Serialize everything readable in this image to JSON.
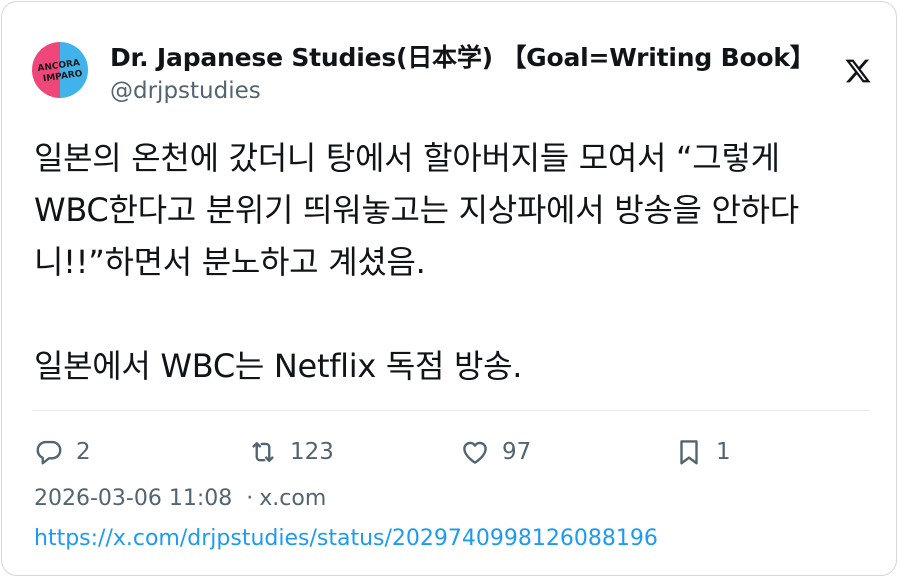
{
  "author": {
    "display_name": "Dr. Japanese Studies(日本学) 【Goal=Writing Book】",
    "handle": "@drjpstudies",
    "avatar_text": "ANCORA IMPARO"
  },
  "platform_icon": "x-logo-icon",
  "tweet": {
    "text": "일본의 온천에 갔더니 탕에서 할아버지들 모여서 “그렇게\nWBC한다고 분위기 띄워놓고는 지상파에서 방송을 안하다\n니!!”하면서 분노하고 계셨음.\n\n일본에서 WBC는 Netflix 독점 방송."
  },
  "actions": {
    "replies": "2",
    "retweets": "123",
    "likes": "97",
    "bookmarks": "1"
  },
  "meta": {
    "timestamp": "2026-03-06 11:08",
    "separator": "·",
    "source": "x.com"
  },
  "link": "https://x.com/drjpstudies/status/2029740998126088196",
  "colors": {
    "text": "#0f1419",
    "secondary": "#536471",
    "link": "#1d9bf0",
    "avatar_left": "#f0477a",
    "avatar_right": "#3fb3ea"
  }
}
